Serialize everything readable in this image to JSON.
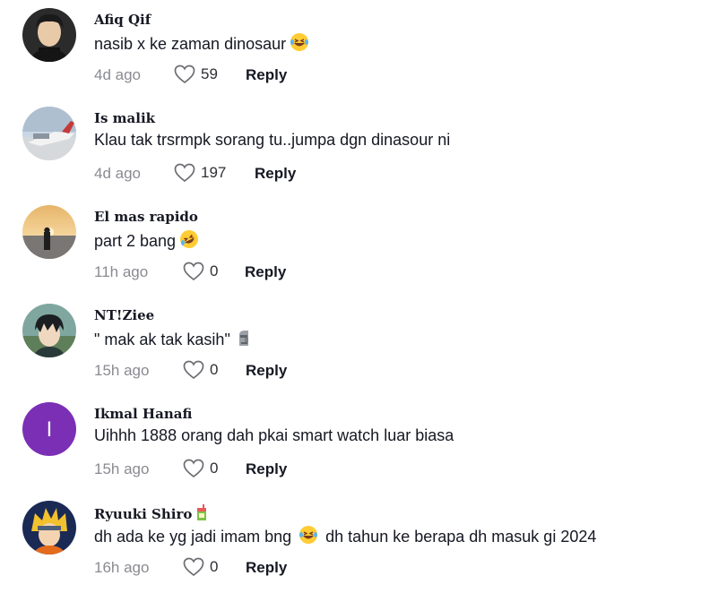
{
  "comments": [
    {
      "username": "Afiq Qif",
      "text": "nasib x ke zaman dinosaur",
      "emoji": "laughing-tears-emoji",
      "time": "4d ago",
      "likes": "59",
      "reply_label": "Reply"
    },
    {
      "username": "Is malik",
      "text": "Klau tak trsrmpk sorang tu..jumpa dgn dinasour ni",
      "time": "4d ago",
      "likes": "197",
      "reply_label": "Reply"
    },
    {
      "username": "El mas rapido",
      "text": "part 2 bang",
      "emoji": "rofl-emoji",
      "time": "11h ago",
      "likes": "0",
      "reply_label": "Reply"
    },
    {
      "username": "NT!Ziee",
      "text": "\" mak ak tak kasih\"",
      "emoji": "moai-emoji",
      "time": "15h ago",
      "likes": "0",
      "reply_label": "Reply"
    },
    {
      "username": "Ikmal Hanafi",
      "avatar_initial": "I",
      "avatar_color": "#7b2fb5",
      "text": "Uihhh 1888 orang dah pkai smart watch luar biasa",
      "time": "15h ago",
      "likes": "0",
      "reply_label": "Reply"
    },
    {
      "username": "Ryuuki Shiro",
      "badge": "juice-box-emoji",
      "text": "dh ada ke yg jadi imam bng",
      "emoji": "laughing-tears-emoji",
      "text_after": "dh tahun ke berapa dh masuk gi 2024",
      "time": "16h ago",
      "likes": "0",
      "reply_label": "Reply"
    }
  ],
  "colors": {
    "text": "#161823",
    "muted": "#8a8b91",
    "background": "#ffffff"
  }
}
